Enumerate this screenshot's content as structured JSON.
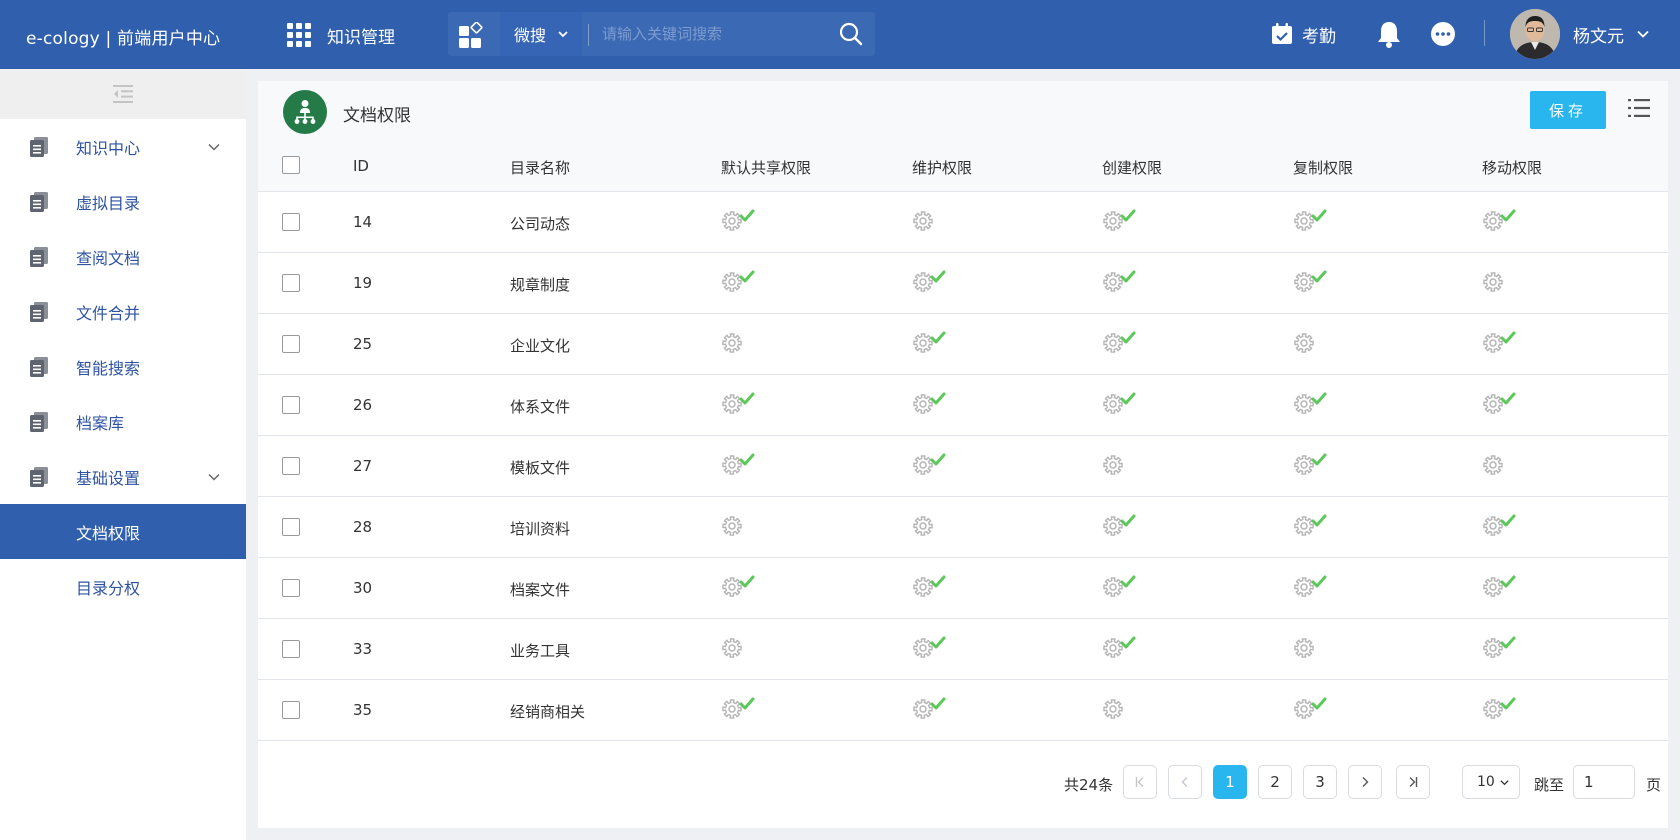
{
  "header": {
    "brand": "e-cology | 前端用户中心",
    "module": "知识管理",
    "search_scope": "微搜",
    "search_placeholder": "请输入关键词搜索",
    "attendance": "考勤",
    "user_name": "杨文元"
  },
  "sidebar": {
    "items": [
      {
        "label": "知识中心",
        "expandable": true
      },
      {
        "label": "虚拟目录",
        "expandable": false
      },
      {
        "label": "查阅文档",
        "expandable": false
      },
      {
        "label": "文件合并",
        "expandable": false
      },
      {
        "label": "智能搜索",
        "expandable": false
      },
      {
        "label": "档案库",
        "expandable": false
      },
      {
        "label": "基础设置",
        "expandable": true
      }
    ],
    "sub_items": [
      {
        "label": "文档权限",
        "active": true
      },
      {
        "label": "目录分权",
        "active": false
      }
    ]
  },
  "panel": {
    "title": "文档权限",
    "save_label": "保存"
  },
  "table": {
    "columns": [
      "ID",
      "目录名称",
      "默认共享权限",
      "维护权限",
      "创建权限",
      "复制权限",
      "移动权限"
    ],
    "rows": [
      {
        "id": "14",
        "name": "公司动态",
        "perms": [
          true,
          false,
          true,
          true,
          true
        ]
      },
      {
        "id": "19",
        "name": "规章制度",
        "perms": [
          true,
          true,
          true,
          true,
          false
        ]
      },
      {
        "id": "25",
        "name": "企业文化",
        "perms": [
          false,
          true,
          true,
          false,
          true
        ]
      },
      {
        "id": "26",
        "name": "体系文件",
        "perms": [
          true,
          true,
          true,
          true,
          true
        ]
      },
      {
        "id": "27",
        "name": "模板文件",
        "perms": [
          true,
          true,
          false,
          true,
          false
        ]
      },
      {
        "id": "28",
        "name": "培训资料",
        "perms": [
          false,
          false,
          true,
          true,
          true
        ]
      },
      {
        "id": "30",
        "name": "档案文件",
        "perms": [
          true,
          true,
          true,
          true,
          true
        ]
      },
      {
        "id": "33",
        "name": "业务工具",
        "perms": [
          false,
          true,
          true,
          false,
          true
        ]
      },
      {
        "id": "35",
        "name": "经销商相关",
        "perms": [
          true,
          true,
          false,
          true,
          true
        ]
      }
    ]
  },
  "pagination": {
    "total": "共24条",
    "pages": [
      "1",
      "2",
      "3"
    ],
    "current": "1",
    "page_size": "10",
    "jump_label": "跳至",
    "jump_value": "1",
    "page_suffix": "页"
  },
  "colors": {
    "header_bg": "#3060ad",
    "accent": "#29b6ef",
    "check": "#5cc85a",
    "panel_icon": "#257b48"
  }
}
